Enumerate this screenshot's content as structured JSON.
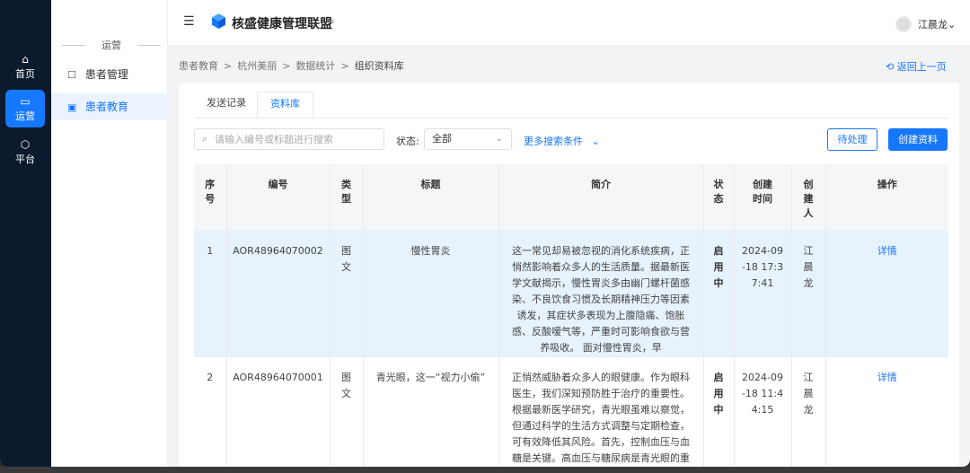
{
  "rail": [
    {
      "icon": "home-icon",
      "glyph": "⌂",
      "label": "首页",
      "active": false
    },
    {
      "icon": "monitor-icon",
      "glyph": "▭",
      "label": "运营",
      "active": true
    },
    {
      "icon": "cube-icon",
      "glyph": "⬡",
      "label": "平台",
      "active": false
    }
  ],
  "submenu": {
    "group": "运营",
    "items": [
      {
        "icon": "patient-icon",
        "glyph": "☐",
        "label": "患者管理"
      },
      {
        "icon": "education-icon",
        "glyph": "▣",
        "label": "患者教育"
      }
    ]
  },
  "header": {
    "menu_glyph": "☰",
    "brand": "核盛健康管理联盟",
    "swap_glyph": "⇋",
    "username": "江晨龙",
    "username_chev": "⌄"
  },
  "breadcrumb": {
    "items": [
      "患者教育",
      "杭州美丽",
      "数据统计"
    ],
    "sep": ">",
    "current": "组织资料库",
    "back": "⟲ 返回上一页"
  },
  "tabs": [
    "发送记录",
    "资料库"
  ],
  "filters": {
    "search_glyph": "⌕",
    "search_placeholder": "请输入编号或标题进行搜索",
    "status_label": "状态:",
    "status_value": "全部",
    "status_chev": "⌄",
    "more": "更多搜索条件",
    "more_chev": "⌄",
    "pending": "待处理",
    "create": "创建资料"
  },
  "table": {
    "headers": [
      "序号",
      "编号",
      "类型",
      "标题",
      "简介",
      "状态",
      "创建时间",
      "创建人",
      "操作"
    ],
    "rows": [
      {
        "index": "1",
        "code": "AOR48964070002",
        "type": "图文",
        "title": "慢性胃炎",
        "intro": "这一常见却易被忽视的消化系统疾病，正悄然影响着众多人的生活质量。据最新医学文献揭示，慢性胃炎多由幽门螺杆菌感染、不良饮食习惯及长期精神压力等因素诱发，其症状多表现为上腹隐痛、饱胀感、反酸嗳气等，严重时可影响食欲与营养吸收。 面对慢性胃炎，早",
        "status": "启用中",
        "created": "2024-09-18 17:37:41",
        "creator": "江晨龙",
        "action": "详情"
      },
      {
        "index": "2",
        "code": "AOR48964070001",
        "type": "图文",
        "title": "青光眼，这一“视力小偷”",
        "intro": "正悄然威胁着众多人的眼健康。作为眼科医生，我们深知预防胜于治疗的重要性。根据最新医学研究，青光眼虽难以察觉，但通过科学的生活方式调整与定期检查，可有效降低其风险。首先，控制血压与血糖是关键。高血压与糖尿病是青光眼的重要诱因，定期监测并遵医嘱",
        "status": "启用中",
        "created": "2024-09-18 11:44:15",
        "creator": "江晨龙",
        "action": "详情"
      }
    ]
  },
  "colors": {
    "primary": "#1677ff",
    "rail": "#0c1a2e",
    "row_highlight": "#e6f2fc"
  }
}
